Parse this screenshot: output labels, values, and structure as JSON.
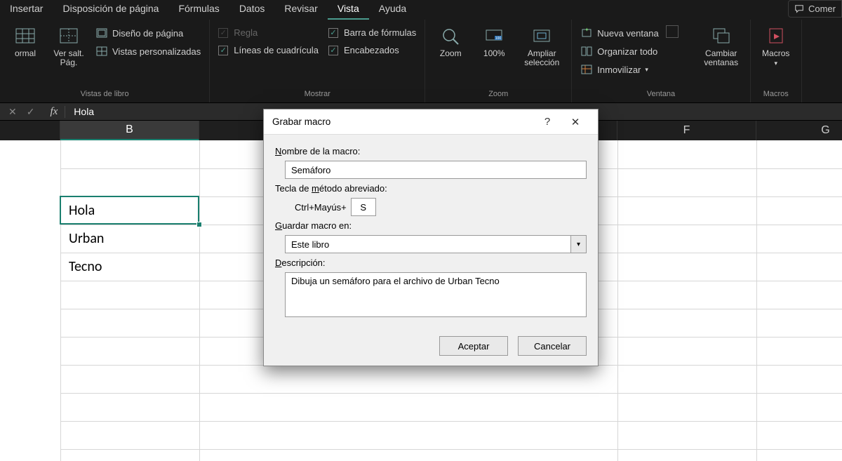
{
  "tabs": {
    "insertar": "Insertar",
    "disposicion": "Disposición de página",
    "formulas": "Fórmulas",
    "datos": "Datos",
    "revisar": "Revisar",
    "vista": "Vista",
    "ayuda": "Ayuda",
    "comentarios": "Comer"
  },
  "ribbon": {
    "vistas": {
      "normal": "ormal",
      "salto": "Ver salt.\nPág.",
      "diseno": "Diseño de página",
      "personalizadas": "Vistas personalizadas",
      "label": "Vistas de libro"
    },
    "mostrar": {
      "regla": "Regla",
      "cuadricula": "Líneas de cuadrícula",
      "barra_formulas": "Barra de fórmulas",
      "encabezados": "Encabezados",
      "label": "Mostrar"
    },
    "zoom": {
      "zoom": "Zoom",
      "cien": "100%",
      "ampliar": "Ampliar\nselección",
      "label": "Zoom"
    },
    "ventana": {
      "nueva": "Nueva ventana",
      "organizar": "Organizar todo",
      "inmovilizar": "Inmovilizar",
      "cambiar": "Cambiar\nventanas",
      "label": "Ventana"
    },
    "macros": {
      "macros": "Macros",
      "label": "Macros"
    }
  },
  "formula_bar": {
    "value": "Hola"
  },
  "columns": [
    "B",
    "F",
    "G"
  ],
  "cells": {
    "b3": "Hola",
    "b4": "Urban",
    "b5": "Tecno"
  },
  "dialog": {
    "title": "Grabar macro",
    "name_label_pre": "N",
    "name_label_post": "ombre de la macro:",
    "name_value": "Semáforo",
    "shortcut_label_pre": "Tecla de ",
    "shortcut_label_u": "m",
    "shortcut_label_post": "étodo abreviado:",
    "shortcut_prefix": "Ctrl+Mayús+",
    "shortcut_key": "S",
    "store_label_u": "G",
    "store_label_post": "uardar macro en:",
    "store_value": "Este libro",
    "desc_label_u": "D",
    "desc_label_post": "escripción:",
    "desc_value": "Dibuja un semáforo para el archivo de Urban Tecno",
    "ok": "Aceptar",
    "cancel": "Cancelar"
  }
}
